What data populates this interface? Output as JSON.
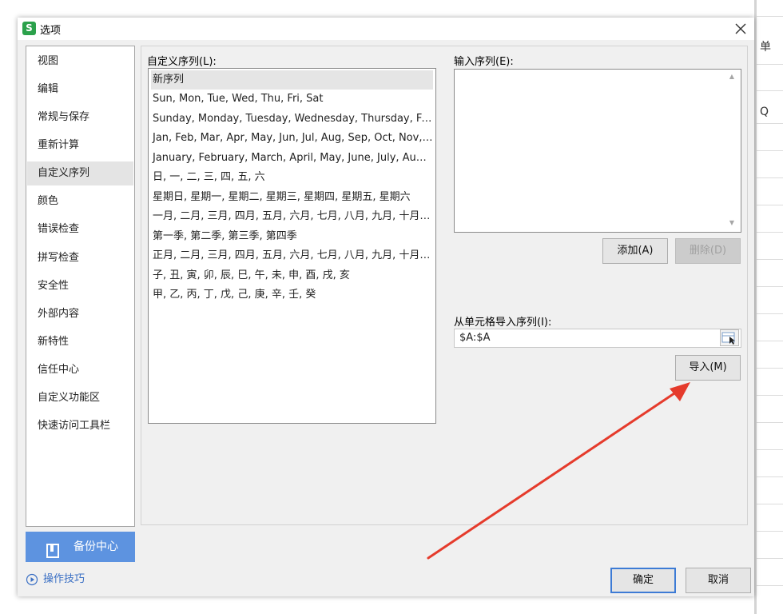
{
  "window": {
    "app_icon_letter": "S",
    "title": "选项",
    "close_icon": "close-icon"
  },
  "background_sheet": {
    "visible_chars": [
      "单",
      "Q"
    ]
  },
  "sidebar": {
    "items": [
      {
        "label": "视图"
      },
      {
        "label": "编辑"
      },
      {
        "label": "常规与保存"
      },
      {
        "label": "重新计算"
      },
      {
        "label": "自定义序列",
        "active": true
      },
      {
        "label": "颜色"
      },
      {
        "label": "错误检查"
      },
      {
        "label": "拼写检查"
      },
      {
        "label": "安全性"
      },
      {
        "label": "外部内容"
      },
      {
        "label": "新特性"
      },
      {
        "label": "信任中心"
      },
      {
        "label": "自定义功能区"
      },
      {
        "label": "快速访问工具栏"
      }
    ],
    "backup_label": "备份中心",
    "backup_icon": "backup-icon",
    "tips_label": "操作技巧",
    "tips_icon": "play-circle-icon"
  },
  "custom_lists": {
    "label": "自定义序列(L):",
    "items": [
      "新序列",
      "Sun, Mon, Tue, Wed, Thu, Fri, Sat",
      "Sunday, Monday, Tuesday, Wednesday, Thursday, Frid...",
      "Jan, Feb, Mar, Apr, May, Jun, Jul, Aug, Sep, Oct, Nov, ...",
      "January, February, March, April, May, June, July, Augus...",
      "日, 一, 二, 三, 四, 五, 六",
      "星期日, 星期一, 星期二, 星期三, 星期四, 星期五, 星期六",
      "一月, 二月, 三月, 四月, 五月, 六月, 七月, 八月, 九月, 十月, ...",
      "第一季, 第二季, 第三季, 第四季",
      "正月, 二月, 三月, 四月, 五月, 六月, 七月, 八月, 九月, 十月, ...",
      "子, 丑, 寅, 卯, 辰, 巳, 午, 未, 申, 酉, 戌, 亥",
      "甲, 乙, 丙, 丁, 戊, 己, 庚, 辛, 壬, 癸"
    ],
    "selected_index": 0
  },
  "input_sequence": {
    "label": "输入序列(E):",
    "value": ""
  },
  "buttons": {
    "add": "添加(A)",
    "delete": "删除(D)",
    "import": "导入(M)",
    "ok": "确定",
    "cancel": "取消"
  },
  "import_from_cells": {
    "label": "从单元格导入序列(I):",
    "value": "$A:$A",
    "pick_icon": "range-select-icon"
  },
  "annotation": {
    "color": "#e53b2c"
  },
  "colors": {
    "accent": "#5d93e0",
    "link": "#3a6fc4",
    "primary_border": "#3d7bd5",
    "logo_green": "#2ba14b"
  }
}
